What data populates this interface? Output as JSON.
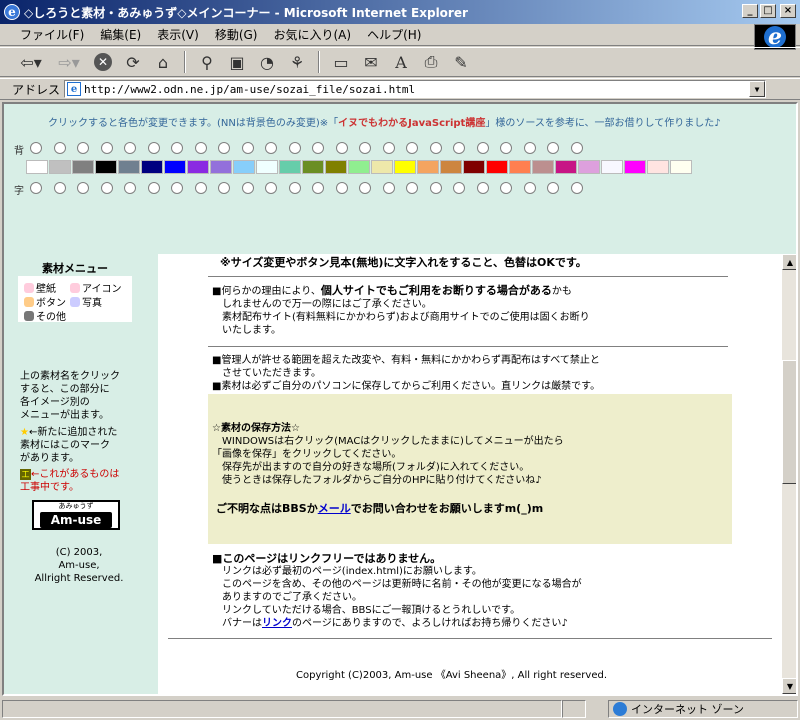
{
  "window": {
    "title": "◇しろうと素材・あみゅうず◇メインコーナー - Microsoft Internet Explorer",
    "btn_min": "_",
    "btn_max": "□",
    "btn_close": "×"
  },
  "menubar": {
    "items": [
      "ファイル(F)",
      "編集(E)",
      "表示(V)",
      "移動(G)",
      "お気に入り(A)",
      "ヘルプ(H)"
    ]
  },
  "toolbar": {
    "icons": [
      "back-arrow-icon",
      "forward-arrow-icon",
      "stop-icon",
      "refresh-icon",
      "home-icon",
      "search-icon",
      "favorites-icon",
      "history-icon",
      "channels-icon",
      "fullscreen-icon",
      "mail-icon",
      "font-icon",
      "print-icon",
      "edit-icon"
    ],
    "back_glyph": "⇦▾",
    "fwd_glyph": "⇨▾"
  },
  "address": {
    "label": "アドレス",
    "url": "http://www2.odn.ne.jp/am-use/sozai_file/sozai.html"
  },
  "colorpicker": {
    "note_pre": "クリックすると各色が変更できます。(NNは背景色のみ変更)※「",
    "note_link": "イヌでもわかるJavaScript講座",
    "note_post": "」様のソースを参考に、一部お借りして作りました♪",
    "bg_label": "背",
    "fg_label": "字",
    "swatches": [
      "#ffffff",
      "#c0c0c0",
      "#808080",
      "#000000",
      "#708090",
      "#000080",
      "#0000ff",
      "#8a2be2",
      "#9370db",
      "#87cefa",
      "#f0ffff",
      "#66cdaa",
      "#6b8e23",
      "#808000",
      "#90ee90",
      "#eee8aa",
      "#ffff00",
      "#f4a460",
      "#cd853f",
      "#800000",
      "#ff0000",
      "#ff7f50",
      "#bc8f8f",
      "#c71585",
      "#dda0dd",
      "#f8f8ff",
      "#ff00ff",
      "#ffe4e1",
      "#fffff0"
    ]
  },
  "left_menu": {
    "title": "素材メニュー",
    "items": [
      {
        "label": "壁紙",
        "color": "#ffccdd"
      },
      {
        "label": "アイコン",
        "color": "#ffccdd"
      },
      {
        "label": "ボタン",
        "color": "#ffcc88"
      },
      {
        "label": "写真",
        "color": "#ccccff"
      },
      {
        "label": "その他",
        "color": "#777777"
      }
    ],
    "info_lines": [
      "上の素材名をクリック",
      "すると、この部分に",
      "各イメージ別の",
      "メニューが出ます。"
    ],
    "new_lines": [
      "←新たに追加された",
      "素材にはこのマーク",
      "があります。"
    ],
    "new_star": "★",
    "wip_mark": "工",
    "wip_lines": [
      "←これがあるものは",
      "工事中です。"
    ],
    "logo_ruby": "あみゅうず",
    "logo_text": "Am-use",
    "copy_lines": [
      "(C) 2003,",
      "Am-use,",
      "Allright Reserved."
    ]
  },
  "main": {
    "p0": "※サイズ変更やボタン見本(無地)に文字入れをすること、色替はOKです。",
    "p1_pre": "■何らかの理由により、",
    "p1_bold": "個人サイトでもご利用をお断りする場合がある",
    "p1_post": "かも",
    "p1_l2": "しれませんので万一の際にはご了承ください。",
    "p1_l3": "素材配布サイト(有料無料にかかわらず)および商用サイトでのご使用は固くお断り",
    "p1_l4": "いたします。",
    "p2_l1": "■管理人が許せる範囲を超えた改変や、有料・無料にかかわらず再配布はすべて禁止と",
    "p2_l2": "させていただきます。",
    "p2_l3": "■素材は必ずご自分のパソコンに保存してからご利用ください。直リンクは厳禁です。",
    "save_title": "☆素材の保存方法☆",
    "save_l1": "WINDOWSは右クリック(MACはクリックしたままに)してメニューが出たら",
    "save_l2": "「画像を保存」をクリックしてください。",
    "save_l3": "保存先が出ますので自分の好きな場所(フォルダ)に入れてください。",
    "save_l4": "使うときは保存したフォルダからご自分のHPに貼り付けてくださいね♪",
    "contact_pre": "ご不明な点はBBSか",
    "contact_link": "メール",
    "contact_post": "でお問い合わせをお願いしますm(_)m",
    "p3_title": "■このページはリンクフリーではありません。",
    "p3_l1": "リンクは必ず最初のページ(index.html)にお願いします。",
    "p3_l2": "このページを含め、その他のページは更新時に名前・その他が変更になる場合が",
    "p3_l3": "ありますのでご了承ください。",
    "p3_l4": "リンクしていただける場合、BBSにご一報頂けるとうれしいです。",
    "p3_l5_pre": "バナーは",
    "p3_l5_link": "リンク",
    "p3_l5_post": "のページにありますので、よろしければお持ち帰りください♪",
    "copyright": "Copyright (C)2003, Am-use 《Avi Sheena》, All right reserved."
  },
  "scrollbar": {
    "up": "▲",
    "down": "▼"
  },
  "status": {
    "zone": "インターネット ゾーン"
  }
}
